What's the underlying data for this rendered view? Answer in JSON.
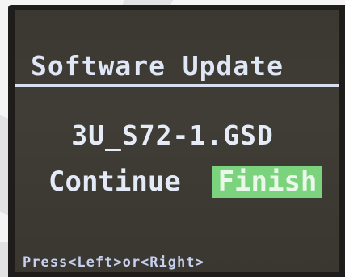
{
  "screen": {
    "title": "Software Update",
    "filename": "3U_S72-1.GSD",
    "options": {
      "continue_label": "Continue",
      "finish_label": "Finish",
      "selected": "Finish"
    },
    "hint": "Press<Left>or<Right>"
  },
  "colors": {
    "screen_bg": "#3b3832",
    "text": "#e3e9f6",
    "highlight": "#7bd47d"
  }
}
